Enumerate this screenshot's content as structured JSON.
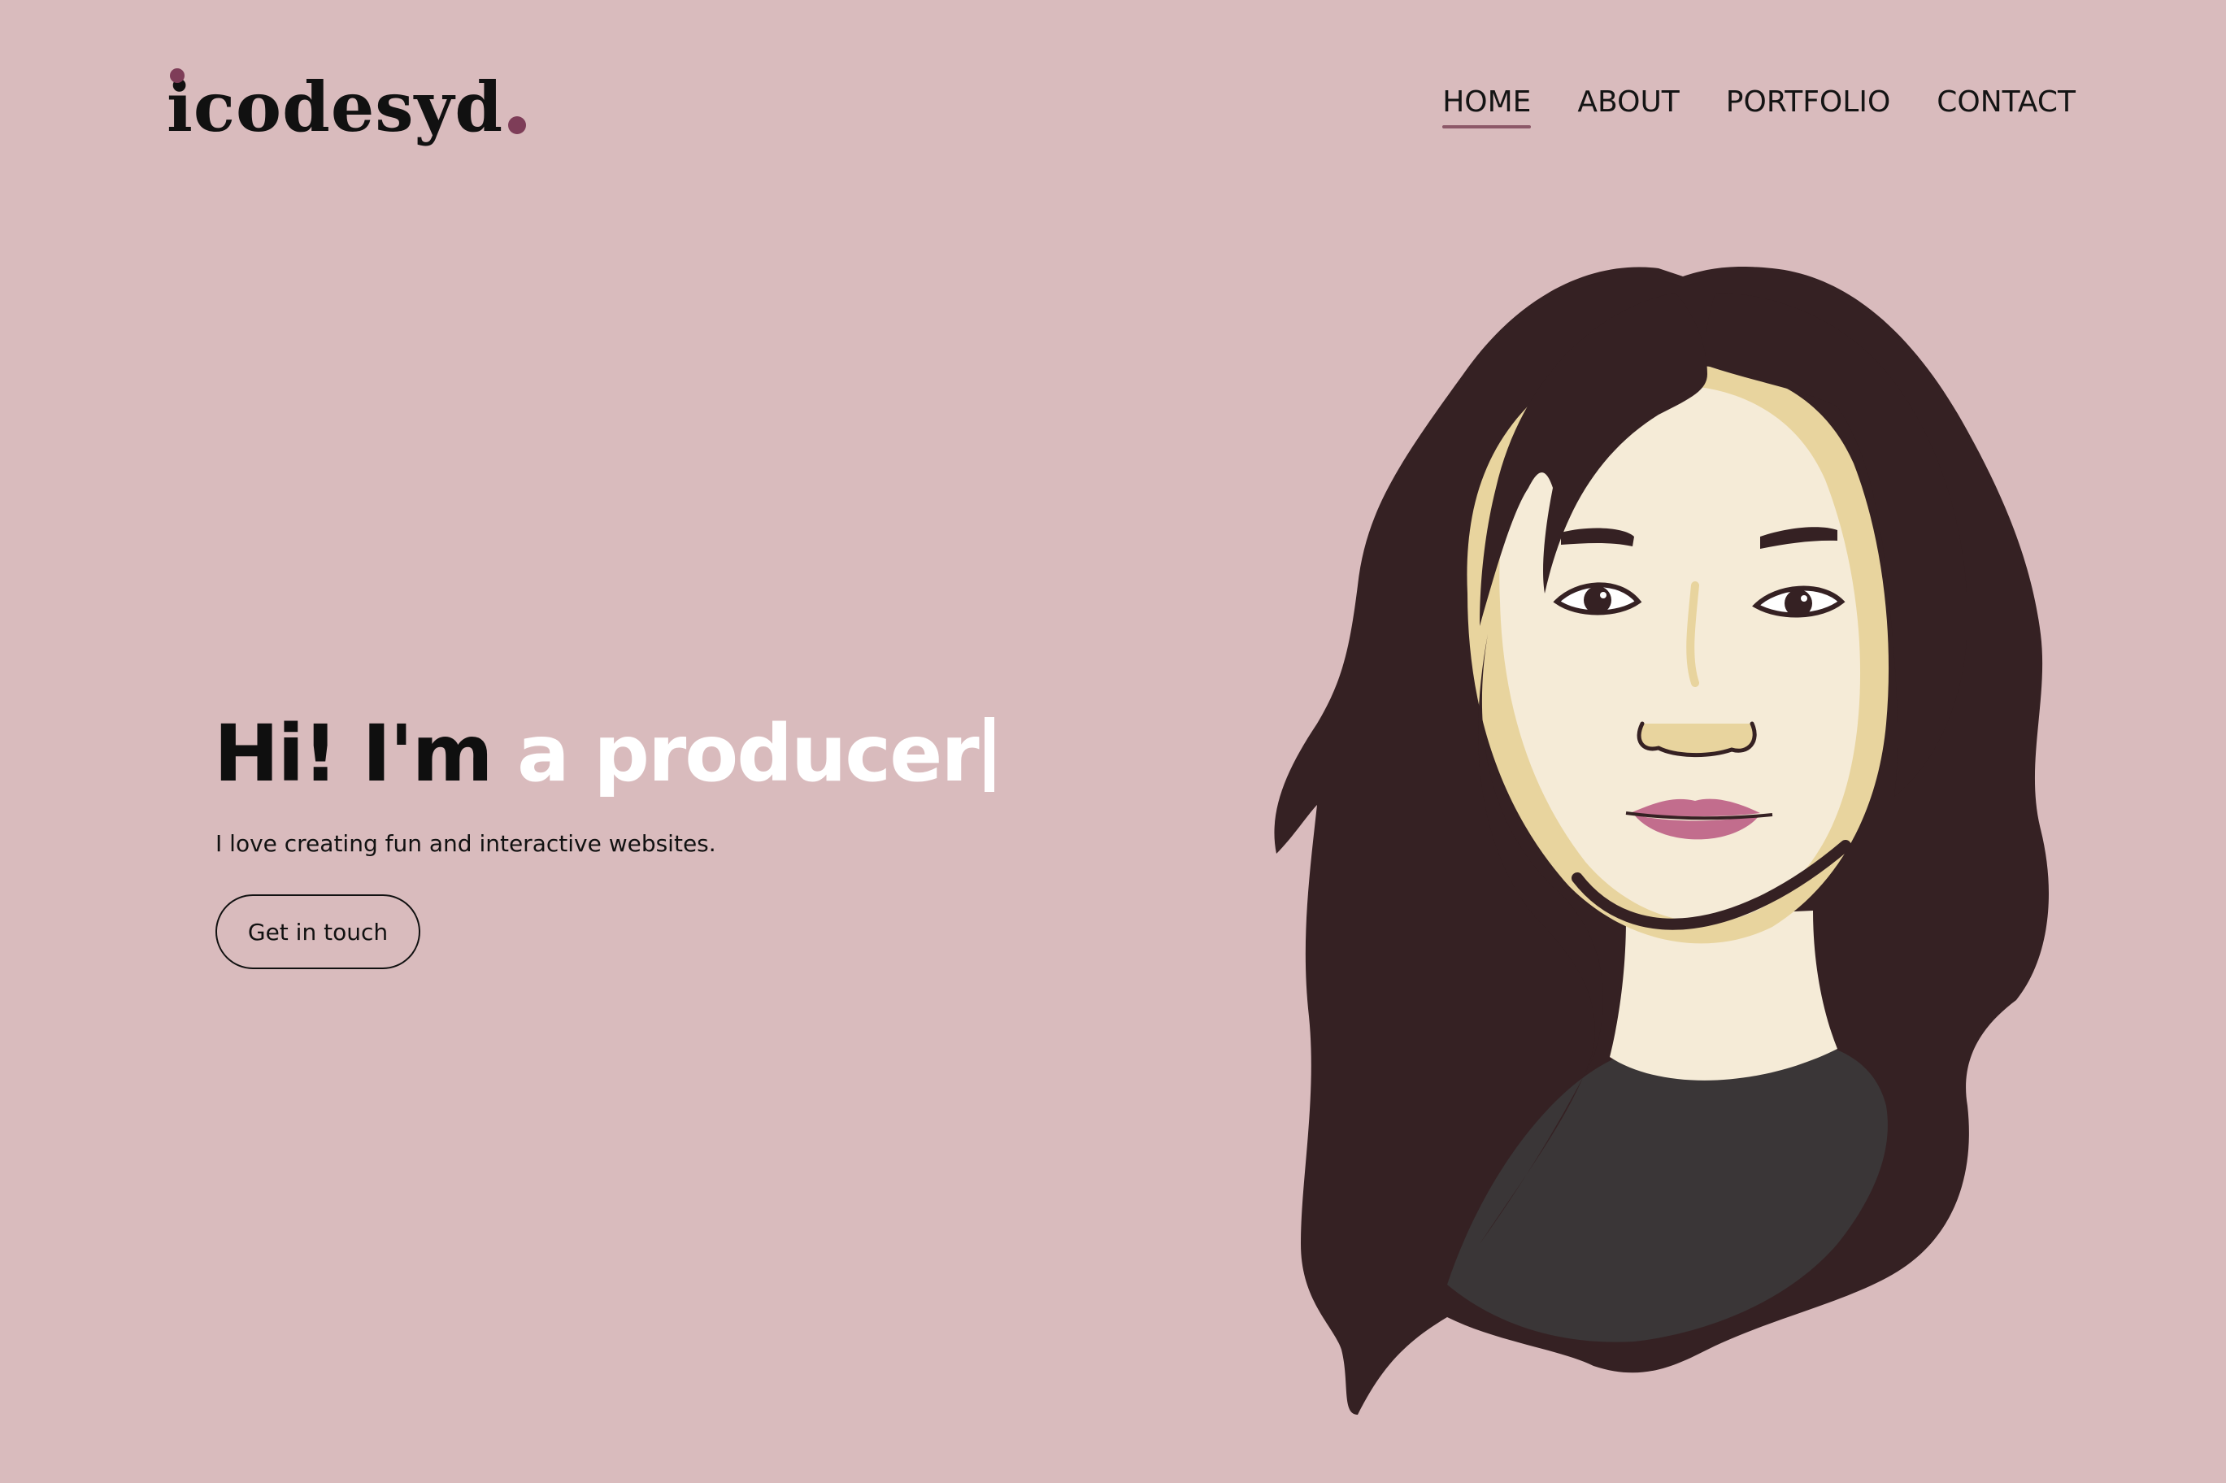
{
  "logo": {
    "text": "icodesyd",
    "dot_color": "#7e3d58"
  },
  "nav": {
    "items": [
      {
        "label": "HOME",
        "active": true
      },
      {
        "label": "ABOUT",
        "active": false
      },
      {
        "label": "PORTFOLIO",
        "active": false
      },
      {
        "label": "CONTACT",
        "active": false
      }
    ]
  },
  "hero": {
    "greeting": "Hi! I'm",
    "role": "a producer",
    "subtitle": "I love creating fun and interactive websites.",
    "cta_label": "Get in touch"
  },
  "colors": {
    "background": "#d9bbbd",
    "accent": "#7e3d58",
    "hair": "#352123",
    "skin": "#f5ebd7",
    "lips": "#c26d8d",
    "shirt": "#3a3637"
  },
  "portrait": {
    "icon": "illustrated-portrait"
  }
}
